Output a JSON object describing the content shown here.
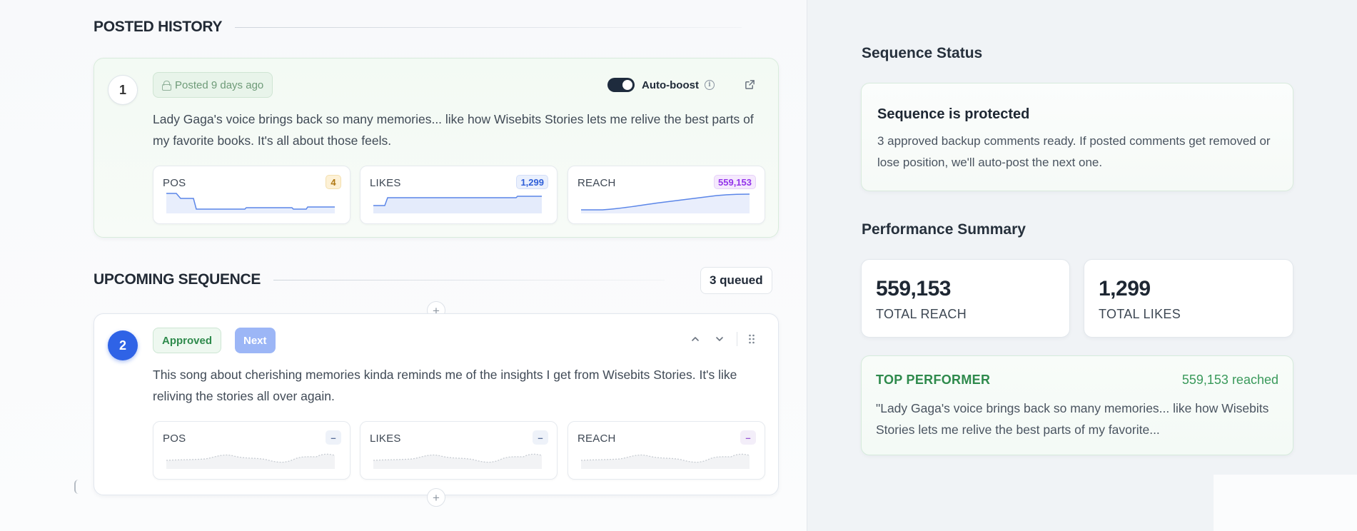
{
  "posted_history": {
    "title": "POSTED HISTORY",
    "item": {
      "number": "1",
      "status_label": "Posted 9 days ago",
      "auto_boost_label": "Auto-boost",
      "auto_boost_enabled": true,
      "text": "Lady Gaga's voice brings back so many memories... like how Wisebits Stories lets me relive the best parts of my favorite books. It's all about those feels.",
      "metrics": [
        {
          "label": "POS",
          "value": "4"
        },
        {
          "label": "LIKES",
          "value": "1,299"
        },
        {
          "label": "REACH",
          "value": "559,153"
        }
      ]
    }
  },
  "upcoming_sequence": {
    "title": "UPCOMING SEQUENCE",
    "queued_label": "3 queued",
    "add_symbol": "+",
    "item": {
      "number": "2",
      "approved_label": "Approved",
      "next_label": "Next",
      "text": "This song about cherishing memories kinda reminds me of the insights I get from Wisebits Stories. It's like reliving the stories all over again.",
      "metrics": [
        {
          "label": "POS",
          "value": "–"
        },
        {
          "label": "LIKES",
          "value": "–"
        },
        {
          "label": "REACH",
          "value": "–"
        }
      ]
    }
  },
  "sequence_status": {
    "title": "Sequence Status",
    "heading": "Sequence is protected",
    "description": "3 approved backup comments ready. If posted comments get removed or lose position, we'll auto-post the next one."
  },
  "performance_summary": {
    "title": "Performance Summary",
    "total_reach_value": "559,153",
    "total_reach_label": "TOTAL REACH",
    "total_likes_value": "1,299",
    "total_likes_label": "TOTAL LIKES",
    "top_performer_label": "TOP PERFORMER",
    "top_performer_reach": "559,153 reached",
    "top_performer_text": "\"Lady Gaga's voice brings back so many memories... like how Wisebits Stories lets me relive the best parts of my favorite..."
  },
  "colors": {
    "accent_blue": "#2f63e6",
    "success_green": "#2e8a4c",
    "pos_orange": "#b07814",
    "reach_purple": "#9333ea"
  },
  "icons": [
    "lock-icon",
    "info-icon",
    "external-link-icon",
    "chevron-up-icon",
    "chevron-down-icon",
    "drag-handle-icon",
    "plus-icon"
  ]
}
